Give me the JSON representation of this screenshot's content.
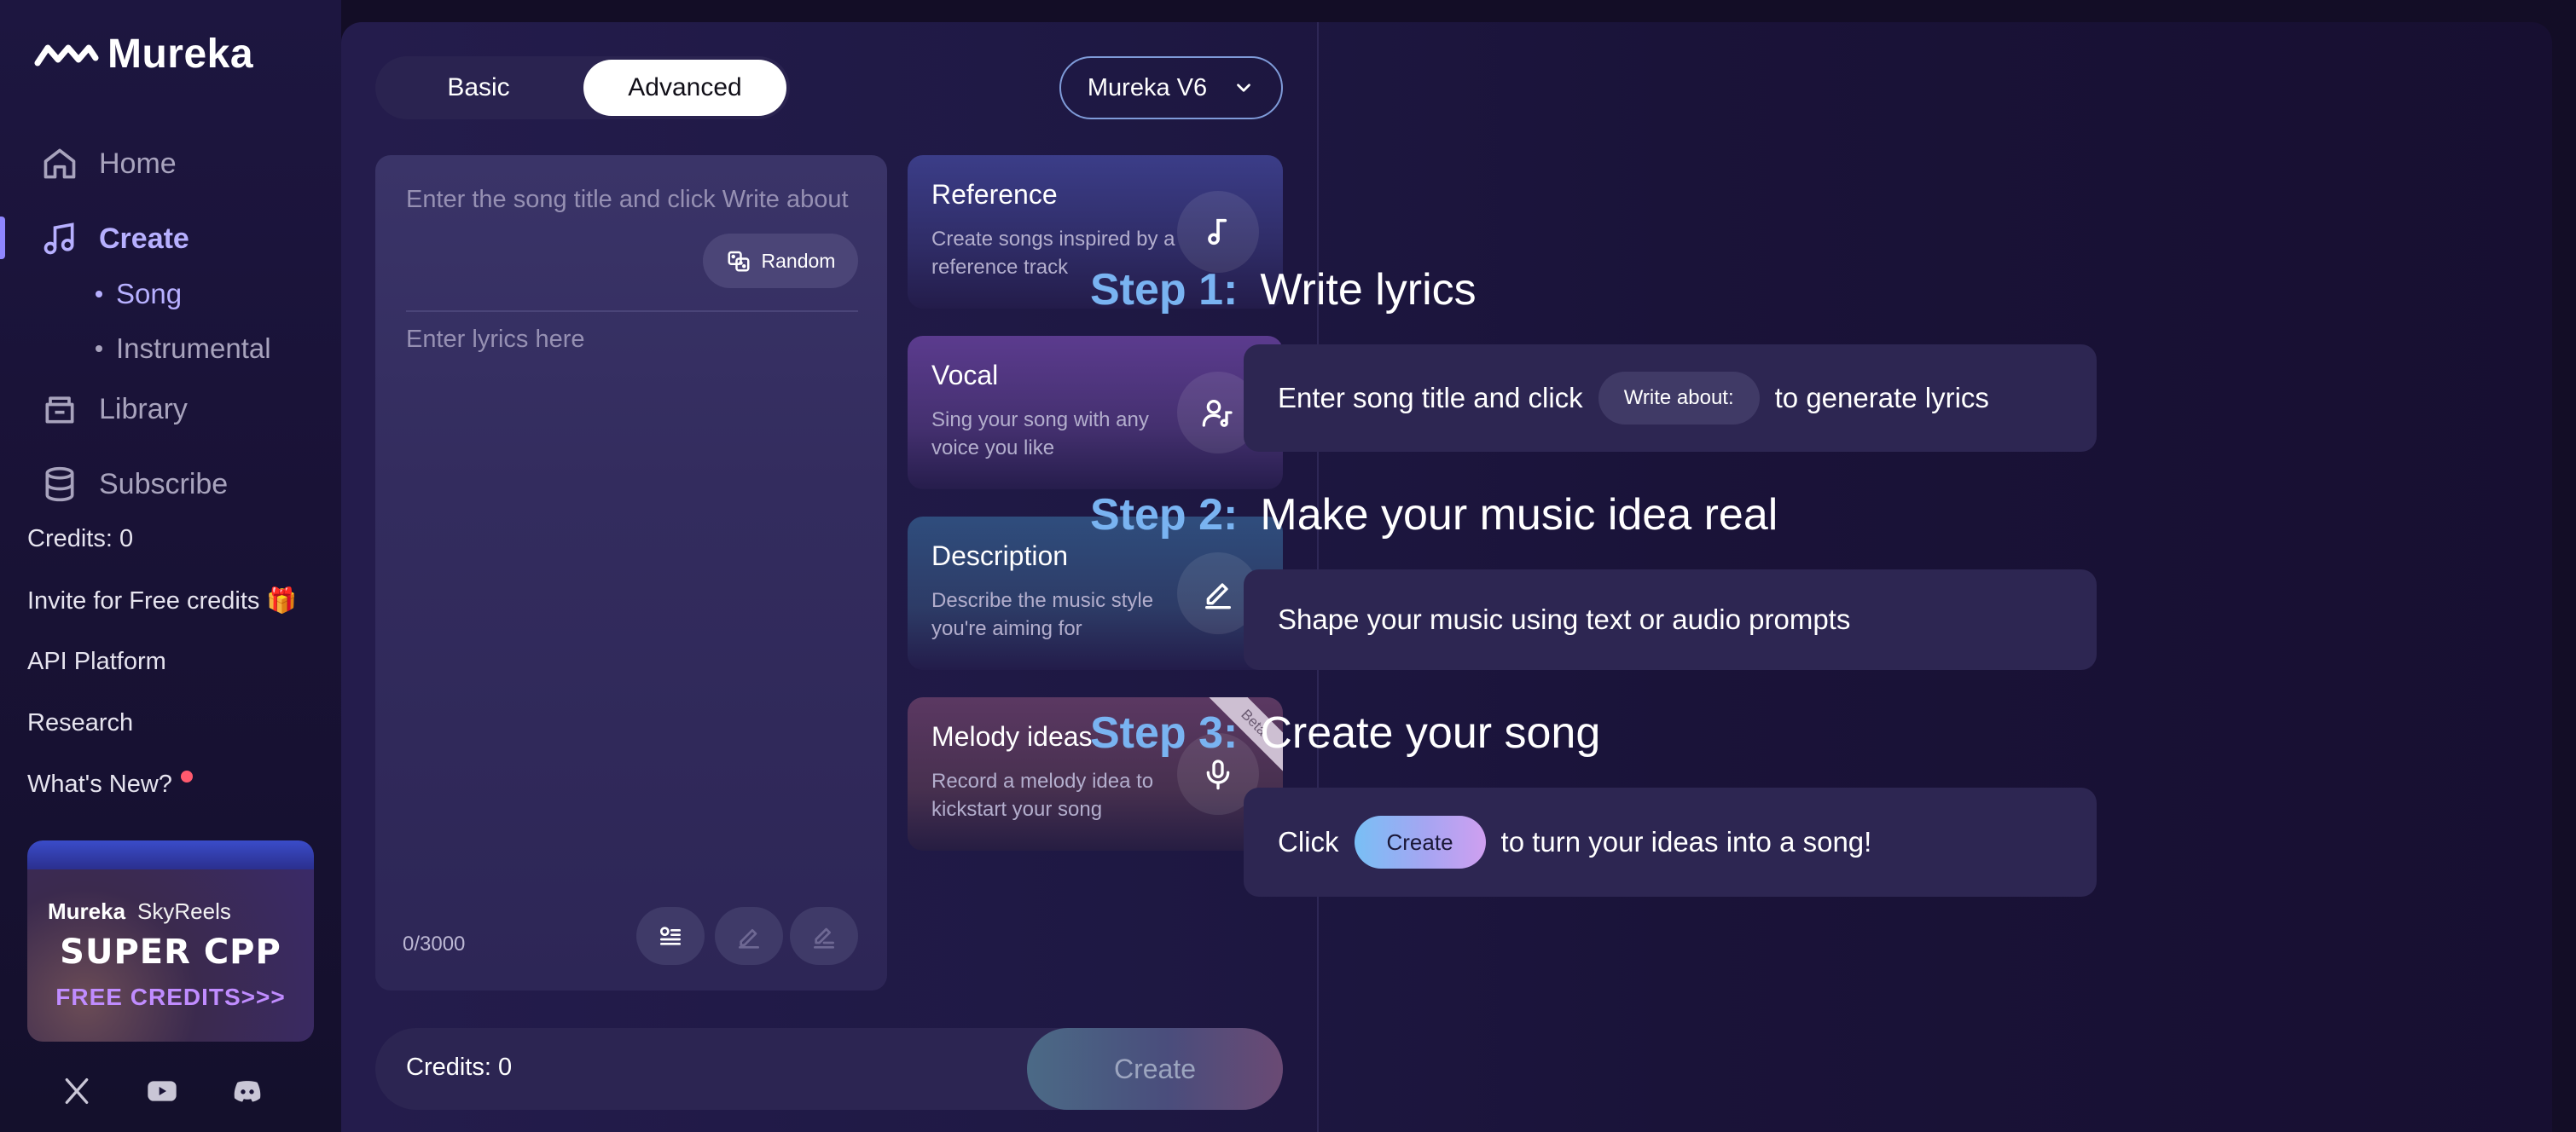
{
  "app": {
    "name": "Mureka"
  },
  "sidebar": {
    "nav": [
      {
        "label": "Home",
        "icon": "home-icon"
      },
      {
        "label": "Create",
        "icon": "music-note-icon",
        "active": true
      },
      {
        "label": "Library",
        "icon": "library-icon"
      },
      {
        "label": "Subscribe",
        "icon": "database-icon"
      }
    ],
    "create_sub": [
      {
        "label": "Song",
        "active": true
      },
      {
        "label": "Instrumental"
      }
    ],
    "credits": "Credits: 0",
    "links": [
      {
        "label": "Invite for Free credits 🎁"
      },
      {
        "label": "API Platform"
      },
      {
        "label": "Research"
      },
      {
        "label": "What's New?"
      }
    ],
    "promo": {
      "brand_a": "Mureka",
      "brand_b": "SkyReels",
      "title": "SUPER CPP",
      "subtitle": "FREE CREDITS>>>"
    },
    "socials": [
      "x-icon",
      "youtube-icon",
      "discord-icon"
    ]
  },
  "editor": {
    "modes": {
      "basic": "Basic",
      "advanced": "Advanced",
      "selected": "Advanced"
    },
    "model": "Mureka V6",
    "title_placeholder": "Enter the song title and click Write about",
    "random_label": "Random",
    "lyrics_placeholder": "Enter lyrics here",
    "char_count": "0/3000",
    "cards": [
      {
        "title": "Reference",
        "desc": "Create songs inspired by a reference track",
        "icon": "music-note-icon"
      },
      {
        "title": "Vocal",
        "desc": "Sing your song with any voice you like",
        "icon": "singer-icon"
      },
      {
        "title": "Description",
        "desc": "Describe the music style you're aiming for",
        "icon": "pen-icon"
      },
      {
        "title": "Melody ideas",
        "desc": "Record a melody idea to kickstart your song",
        "icon": "microphone-icon",
        "badge": "Beta"
      }
    ],
    "bottom": {
      "credits": "Credits: 0",
      "create": "Create"
    }
  },
  "steps": [
    {
      "label": "Step 1:",
      "title": "Write lyrics",
      "pre": "Enter song title and click",
      "pill": "Write about:",
      "post": "to generate lyrics"
    },
    {
      "label": "Step 2:",
      "title": "Make your music idea real",
      "text": "Shape your music using text or audio prompts"
    },
    {
      "label": "Step 3:",
      "title": "Create your song",
      "pre": "Click",
      "pill": "Create",
      "post": "to turn your ideas into a song!"
    }
  ],
  "colors": {
    "accent": "#b7b0ff",
    "step_label": "#79b3f1",
    "background": "#130d26"
  }
}
